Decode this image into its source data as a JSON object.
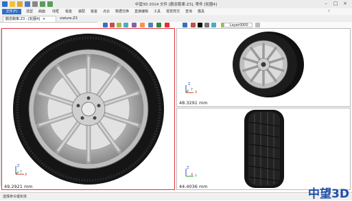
{
  "app": {
    "title": "中望3D 2014    文件 [觀念跑車.Z3], 零件 [轮圈4]"
  },
  "menubar": {
    "file_label": "文件(F)",
    "items": [
      "造型",
      "曲面",
      "线框",
      "钣金",
      "装配",
      "钣金",
      "点云",
      "数据交换",
      "直接编辑",
      "工具",
      "视觉样式",
      "查询",
      "模具"
    ]
  },
  "tabs": [
    {
      "label": "觀念跑車.Z3 - [轮圈4]",
      "active": true
    },
    {
      "label": "viature.Z3",
      "active": false
    }
  ],
  "toolbar": {
    "layer_value": "Layer0000"
  },
  "viewports": {
    "left": {
      "scale": "49.2921 mm",
      "axis_x": "X",
      "axis_y": "Y",
      "axis_z": "Z"
    },
    "top_right": {
      "scale": "48.3291 mm",
      "axis_x": "X",
      "axis_y": "Y",
      "axis_z": "Z"
    },
    "bottom_right": {
      "scale": "44.4036 mm",
      "axis_x": "X",
      "axis_y": "Y",
      "axis_z": "Z"
    }
  },
  "status": {
    "text": "选择命令或实体"
  },
  "brand": {
    "text": "中望3D"
  },
  "colors": {
    "accent": "#2f6fc6",
    "active_viewport_border": "#e0303a",
    "brand": "#1e4ea8"
  }
}
